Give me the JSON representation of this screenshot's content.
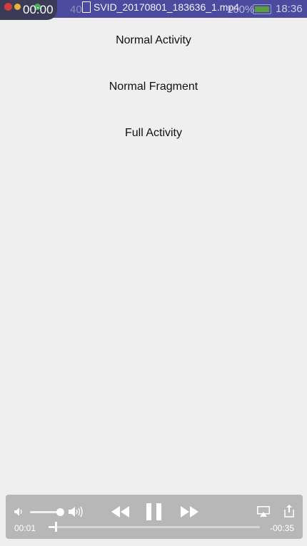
{
  "status_bar": {
    "time_left": "00:00",
    "network_rate": "40",
    "file_name": "SVID_20170801_183636_1.mp4",
    "battery_percent": "100%",
    "time_right": "18:36",
    "colors": {
      "bar": "#4a4a9f",
      "pill": "#3b3b57"
    }
  },
  "menu": {
    "items": [
      {
        "label": "Normal Activity"
      },
      {
        "label": "Normal Fragment"
      },
      {
        "label": "Full Activity"
      }
    ]
  },
  "player": {
    "elapsed": "00:01",
    "remaining": "-00:35",
    "volume_level": 0.85,
    "progress": 0.03,
    "icons": [
      "volume-low-icon",
      "volume-high-icon",
      "rewind-icon",
      "pause-icon",
      "fast-forward-icon",
      "airplay-icon",
      "share-icon"
    ]
  }
}
